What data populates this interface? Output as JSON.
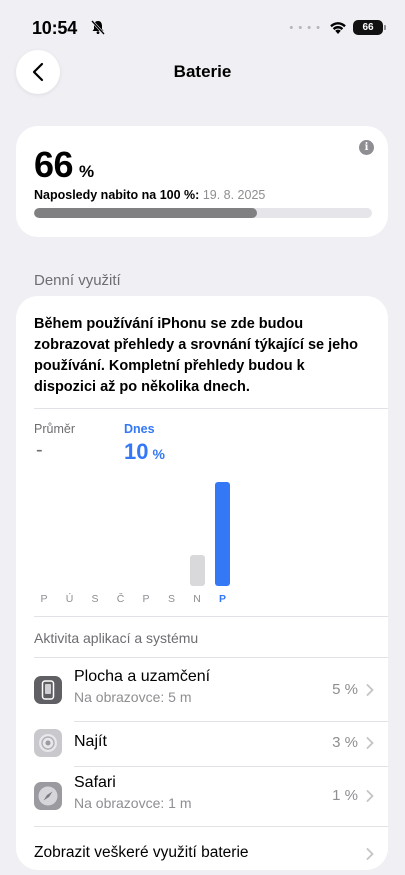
{
  "status_bar": {
    "time": "10:54",
    "battery": "66"
  },
  "nav": {
    "title": "Baterie"
  },
  "battery": {
    "level": "66",
    "unit": "%",
    "last_charged_label": "Naposledy nabito na 100 %:",
    "last_charged_date": "19. 8. 2025",
    "level_fraction": 0.66
  },
  "daily_usage": {
    "section_title": "Denní využití",
    "description": "Během používání iPhonu se zde budou zobrazovat přehledy a srovnání týkající se jeho používání. Kompletní přehledy budou k dispozici až po několika dnech.",
    "average_label": "Průměr",
    "average_value": "-",
    "today_label": "Dnes",
    "today_value": "10",
    "today_unit": "%",
    "days": [
      "P",
      "Ú",
      "S",
      "Č",
      "P",
      "S",
      "N",
      "P"
    ],
    "active_day_index": 7,
    "bar_values": [
      null,
      null,
      null,
      null,
      null,
      null,
      3,
      10
    ]
  },
  "activity": {
    "header": "Aktivita aplikací a systému",
    "apps": [
      {
        "name": "Plocha a uzamčení",
        "sub": "Na obrazovce: 5 m",
        "percent": "5 %",
        "icon": "home-lock-icon"
      },
      {
        "name": "Najít",
        "sub": "",
        "percent": "3 %",
        "icon": "find-my-icon"
      },
      {
        "name": "Safari",
        "sub": "Na obrazovce: 1 m",
        "percent": "1 %",
        "icon": "safari-icon"
      }
    ],
    "show_all": "Zobrazit veškeré využití baterie"
  },
  "colors": {
    "accent": "#3478f6",
    "secondary": "#8e8e93",
    "background": "#efeff4"
  }
}
